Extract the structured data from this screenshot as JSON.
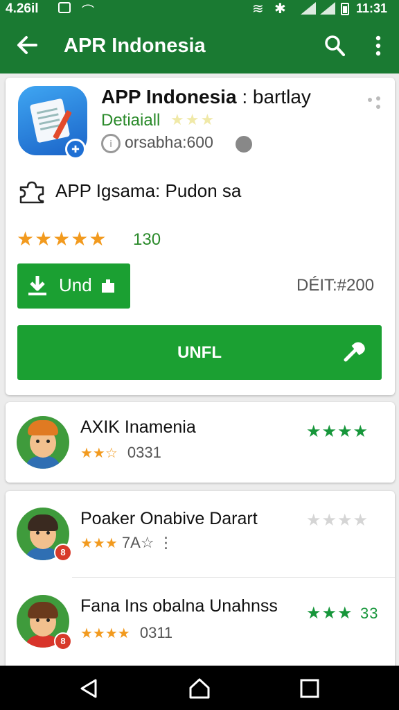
{
  "status_bar": {
    "time_left": "4.26il",
    "time_right": "11:31"
  },
  "app_bar": {
    "title": "APR Indonesia",
    "icons": [
      "back-arrow-icon",
      "search-icon",
      "more-vert-icon"
    ]
  },
  "app": {
    "name_bold": "APP Indonesia",
    "name_light": " : bartlay",
    "developer": "Detiaiall",
    "developer_stars": "★★★",
    "meta": "orsabha:600",
    "tagline": "APP Igsama: Pudon sa",
    "stars": "★★★★★",
    "rating_count": "130",
    "install_small_label": "Und",
    "price": "DÉIT:#200",
    "main_button_label": "UNFL"
  },
  "list": [
    {
      "title": "AXIK Inamenia",
      "sub_stars": "★★☆",
      "sub_text": "0331",
      "right_stars": "★★★★"
    },
    {
      "title": "Poaker Onabive Darart",
      "sub_stars": "★★★",
      "sub_text": "7A☆ ⋮",
      "right_stars": "★★★★",
      "badge": "8"
    },
    {
      "title": "Fana Ins obalna Unahnss",
      "sub_stars": "★★★★",
      "sub_text": "0311",
      "right_stars": "★★★",
      "right_count": "33",
      "badge": "8"
    }
  ],
  "colors": {
    "primary": "#1a7a32",
    "button": "#1ba032",
    "star_orange": "#f29a1e",
    "star_green": "#16963a"
  }
}
